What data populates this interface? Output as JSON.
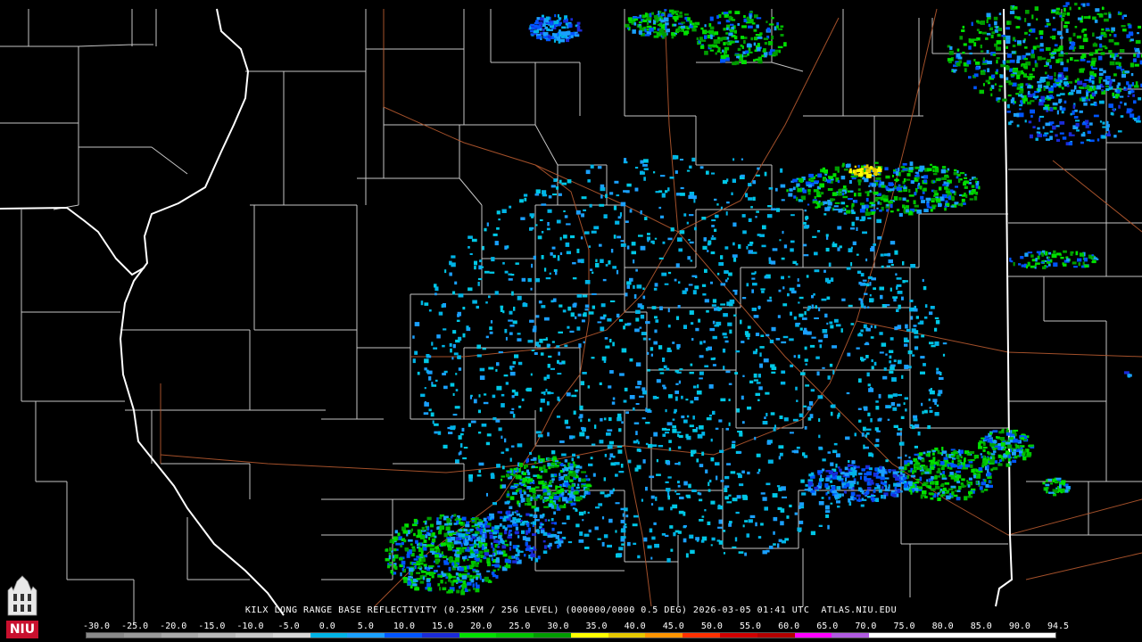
{
  "caption": "KILX LONG RANGE BASE REFLECTIVITY (0.25KM / 256 LEVEL) (000000/0000 0.5 DEG) 2026-03-05 01:41 UTC  ATLAS.NIU.EDU",
  "logo_text": "NIU",
  "colors": {
    "background": "#000000",
    "county_lines": "#ffffff",
    "state_lines": "#ffffff",
    "roads": "#b5592f"
  },
  "scale": {
    "labels": [
      "-30.0",
      "-25.0",
      "-20.0",
      "-15.0",
      "-10.0",
      "-5.0",
      "0.0",
      "5.0",
      "10.0",
      "15.0",
      "20.0",
      "25.0",
      "30.0",
      "35.0",
      "40.0",
      "45.0",
      "50.0",
      "55.0",
      "60.0",
      "65.0",
      "70.0",
      "75.0",
      "80.0",
      "85.0",
      "90.0",
      "94.5"
    ],
    "colors": [
      "#8a8a8a",
      "#9a9a9a",
      "#aaaaaa",
      "#b8b8b8",
      "#c8c8c8",
      "#d8d8d8",
      "#00b4e6",
      "#1aa0ff",
      "#0055ff",
      "#1a2bd8",
      "#00e000",
      "#00c400",
      "#009c00",
      "#ffff00",
      "#e6c800",
      "#ff9400",
      "#ff3000",
      "#d00000",
      "#b40000",
      "#ff00ff",
      "#b05ae0",
      "#ffffff",
      "#ffffff",
      "#ffffff",
      "#ffffff",
      "#ffffff"
    ]
  }
}
